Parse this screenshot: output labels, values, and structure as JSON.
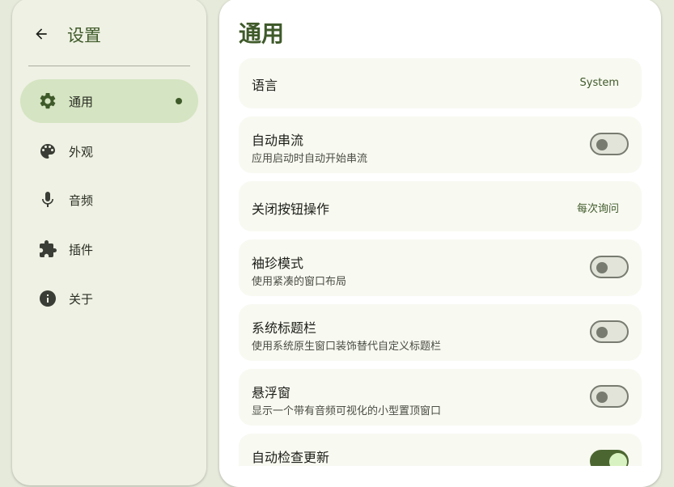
{
  "sidebar": {
    "title": "设置",
    "items": [
      {
        "label": "通用"
      },
      {
        "label": "外观"
      },
      {
        "label": "音频"
      },
      {
        "label": "插件"
      },
      {
        "label": "关于"
      }
    ]
  },
  "main": {
    "title": "通用",
    "settings": [
      {
        "title": "语言",
        "value": "System"
      },
      {
        "title": "自动串流",
        "subtitle": "应用启动时自动开始串流",
        "enabled": false
      },
      {
        "title": "关闭按钮操作",
        "value": "每次询问"
      },
      {
        "title": "袖珍模式",
        "subtitle": "使用紧凑的窗口布局",
        "enabled": false
      },
      {
        "title": "系统标题栏",
        "subtitle": "使用系统原生窗口装饰替代自定义标题栏",
        "enabled": false
      },
      {
        "title": "悬浮窗",
        "subtitle": "显示一个带有音频可视化的小型置顶窗口",
        "enabled": false
      },
      {
        "title": "自动检查更新",
        "enabled": true
      }
    ]
  },
  "colors": {
    "accent": "#3f5a2a",
    "active_nav_bg": "#d5e4c2",
    "toggle_on": "#4c6631"
  }
}
